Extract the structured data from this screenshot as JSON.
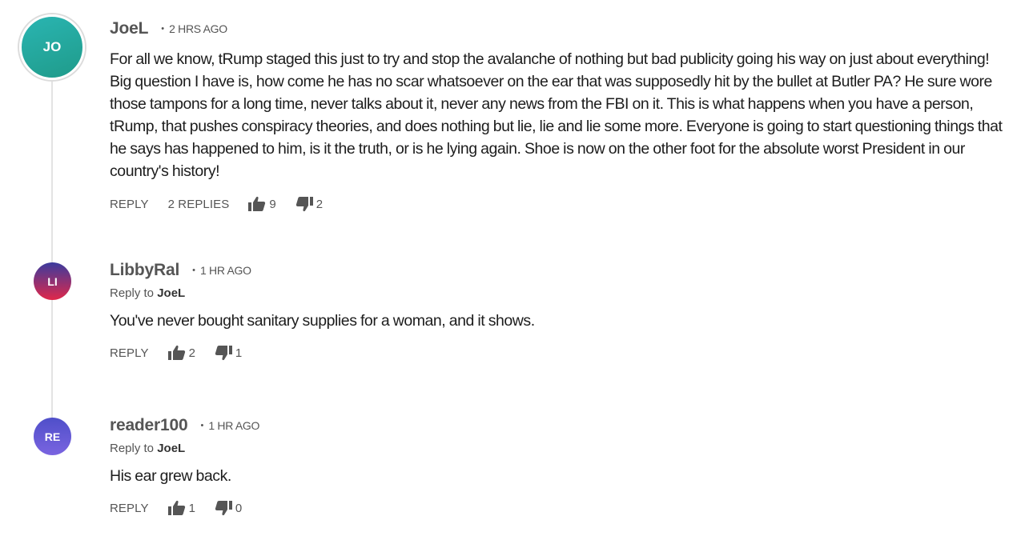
{
  "comments": [
    {
      "initials": "JO",
      "avatar_colors": [
        "#2ab5b2",
        "#1f9b8a"
      ],
      "author": "JoeL",
      "time": "2 HRS AGO",
      "text": "For all we know, tRump staged this just to try and stop the avalanche of nothing but bad publicity going his way on just about everything! Big question I have is, how come he has no scar whatsoever on the ear that was supposedly hit by the bullet at Butler PA? He sure wore those tampons for a long time, never talks about it, never any news from the FBI on it. This is what happens when you have a person, tRump, that pushes conspiracy theories, and does nothing but lie, lie and lie some more. Everyone is going to start questioning things that he says has happened to him, is it the truth, or is he lying again. Shoe is now on the other foot for the absolute worst President in our country's history!",
      "reply_label": "REPLY",
      "replies_label": "2 REPLIES",
      "likes": "9",
      "dislikes": "2"
    },
    {
      "initials": "LI",
      "avatar_colors": [
        "#3b3b9e",
        "#e0284a"
      ],
      "author": "LibbyRal",
      "time": "1 HR AGO",
      "reply_to_prefix": "Reply to",
      "reply_to_name": "JoeL",
      "text": "You've never bought sanitary supplies for a woman, and it shows.",
      "reply_label": "REPLY",
      "likes": "2",
      "dislikes": "1"
    },
    {
      "initials": "RE",
      "avatar_colors": [
        "#4f4fc9",
        "#7a64e0"
      ],
      "author": "reader100",
      "time": "1 HR AGO",
      "reply_to_prefix": "Reply to",
      "reply_to_name": "JoeL",
      "text": "His ear grew back.",
      "reply_label": "REPLY",
      "likes": "1",
      "dislikes": "0"
    }
  ],
  "separator": "•",
  "icons": {
    "like": "thumbs-up-icon",
    "dislike": "thumbs-down-icon"
  },
  "colors": {
    "text": "#1d1d1d",
    "meta": "#555555",
    "thread_line": "#e3e3e3"
  }
}
